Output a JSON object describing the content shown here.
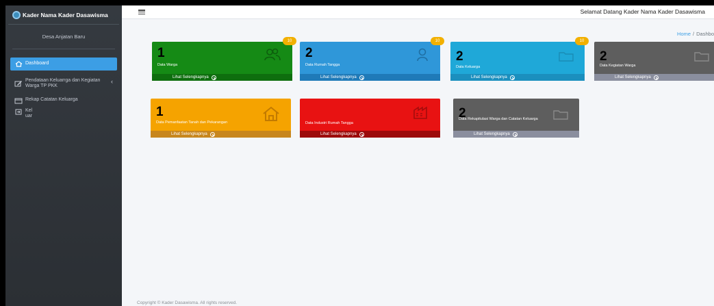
{
  "brand": {
    "title": "Kader Nama Kader Dasawisma"
  },
  "user": {
    "name": "Desa Anjatan Baru"
  },
  "sidebar": {
    "items": [
      {
        "label": "Dashboard",
        "icon": "home-icon"
      },
      {
        "label": "Pendataan Keluarrga dan Kegiatan Warga TP PKK",
        "icon": "edit-icon",
        "caret": "‹"
      },
      {
        "label": "Rekap Catatan Keluarga",
        "icon": "calendar-icon"
      },
      {
        "label": "Kel uar",
        "icon": "logout-icon"
      }
    ]
  },
  "header": {
    "welcome": "Selamat Datang Kader Nama Kader Dasawisma",
    "breadcrumb": {
      "home": "Home",
      "separator": "/",
      "current": "Dashbo"
    }
  },
  "cards": [
    {
      "number": "1",
      "label": "Data Warga",
      "badge": "10",
      "footer": "Lihat Selengkapnya",
      "color": "#158a15",
      "footer_color": "#0e6e0e",
      "icon": "users-icon"
    },
    {
      "number": "2",
      "label": "Data Rumah Tangga",
      "badge": "10",
      "footer": "Lihat Selengkapnya",
      "color": "#2f97d9",
      "footer_color": "#1f7ab8",
      "icon": "user-icon"
    },
    {
      "number": "2",
      "label": "Data Keluarga",
      "badge": "10",
      "footer": "Lihat Selengkapnya",
      "color": "#1fa8d8",
      "footer_color": "#1b8fbe",
      "icon": "folder-icon"
    },
    {
      "number": "2",
      "label": "Data Kegiatan Warga",
      "badge": "",
      "footer": "Lihat Selengkapnya",
      "color": "#5e5e5e",
      "footer_color": "#8a8e9e",
      "icon": "folder-icon"
    },
    {
      "number": "1",
      "label": "Data Pemanfaatan Tanah dan Pekarangan",
      "footer": "Lihat Selengkapnya",
      "color": "#f5a300",
      "footer_color": "#c7861d",
      "icon": "house-icon"
    },
    {
      "number": "",
      "label": "Data Industri Rumah Tangga",
      "footer": "Lihat Selengkapnya",
      "color": "#e81212",
      "footer_color": "#9c0b0b",
      "icon": "factory-icon"
    },
    {
      "number": "2",
      "label": "Data Rekapitulasi Warga dan Catatan Keluarga",
      "footer": "Lihat Selengkapnya",
      "color": "#5e5e5e",
      "footer_color": "#8a8e9e",
      "icon": "folder-icon"
    }
  ],
  "footer": {
    "copyright": "Copyright © Kader Dasawisma. All rights reserved."
  }
}
